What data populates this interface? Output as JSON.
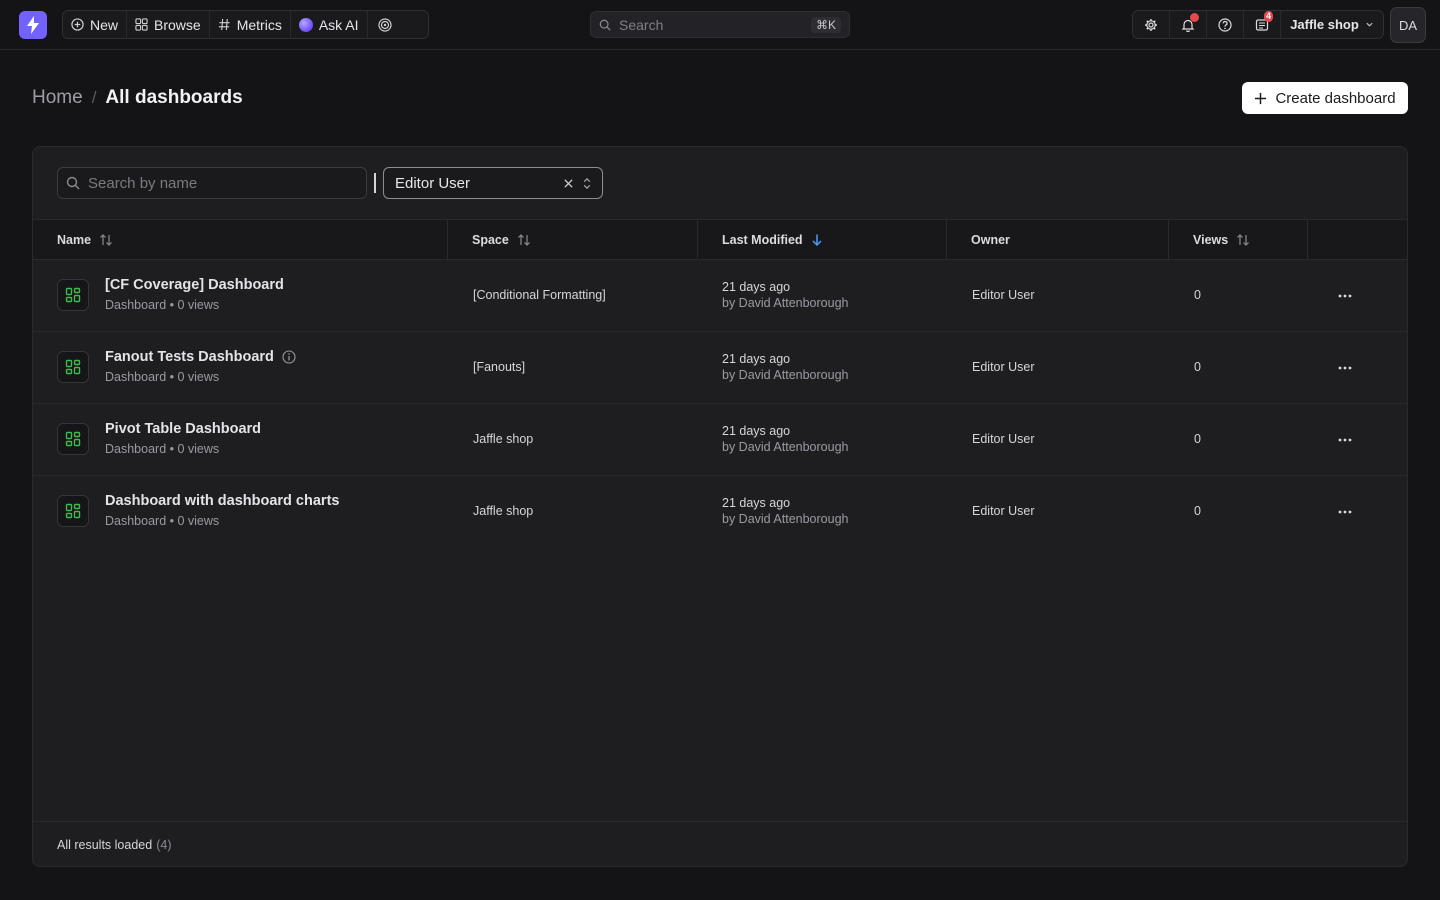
{
  "nav": {
    "new_label": "New",
    "browse_label": "Browse",
    "metrics_label": "Metrics",
    "ask_ai_label": "Ask AI",
    "search_placeholder": "Search",
    "search_shortcut": "⌘K",
    "inbox_badge": "4",
    "project_name": "Jaffle shop",
    "avatar_initials": "DA"
  },
  "header": {
    "breadcrumb_home": "Home",
    "breadcrumb_sep": "/",
    "title": "All dashboards",
    "create_button": "Create dashboard"
  },
  "filters": {
    "search_placeholder": "Search by name",
    "owner_value": "Editor User"
  },
  "table": {
    "columns": {
      "name": "Name",
      "space": "Space",
      "last_modified": "Last Modified",
      "owner": "Owner",
      "views": "Views"
    },
    "rows": [
      {
        "title": "[CF Coverage] Dashboard",
        "subtitle": "Dashboard • 0 views",
        "space": "[Conditional Formatting]",
        "modified": "21 days ago",
        "modified_by": "by David Attenborough",
        "owner": "Editor User",
        "views": "0"
      },
      {
        "title": "Fanout Tests Dashboard",
        "subtitle": "Dashboard • 0 views",
        "space": "[Fanouts]",
        "modified": "21 days ago",
        "modified_by": "by David Attenborough",
        "owner": "Editor User",
        "views": "0"
      },
      {
        "title": "Pivot Table Dashboard",
        "subtitle": "Dashboard • 0 views",
        "space": "Jaffle shop",
        "modified": "21 days ago",
        "modified_by": "by David Attenborough",
        "owner": "Editor User",
        "views": "0"
      },
      {
        "title": "Dashboard with dashboard charts",
        "subtitle": "Dashboard • 0 views",
        "space": "Jaffle shop",
        "modified": "21 days ago",
        "modified_by": "by David Attenborough",
        "owner": "Editor User",
        "views": "0"
      }
    ]
  },
  "footer": {
    "label": "All results loaded",
    "count": "(4)"
  },
  "colors": {
    "brand": "#7262ff",
    "accent_sort": "#4a9eff",
    "dashboard_icon": "#3fb950",
    "notification": "#e5484d"
  }
}
